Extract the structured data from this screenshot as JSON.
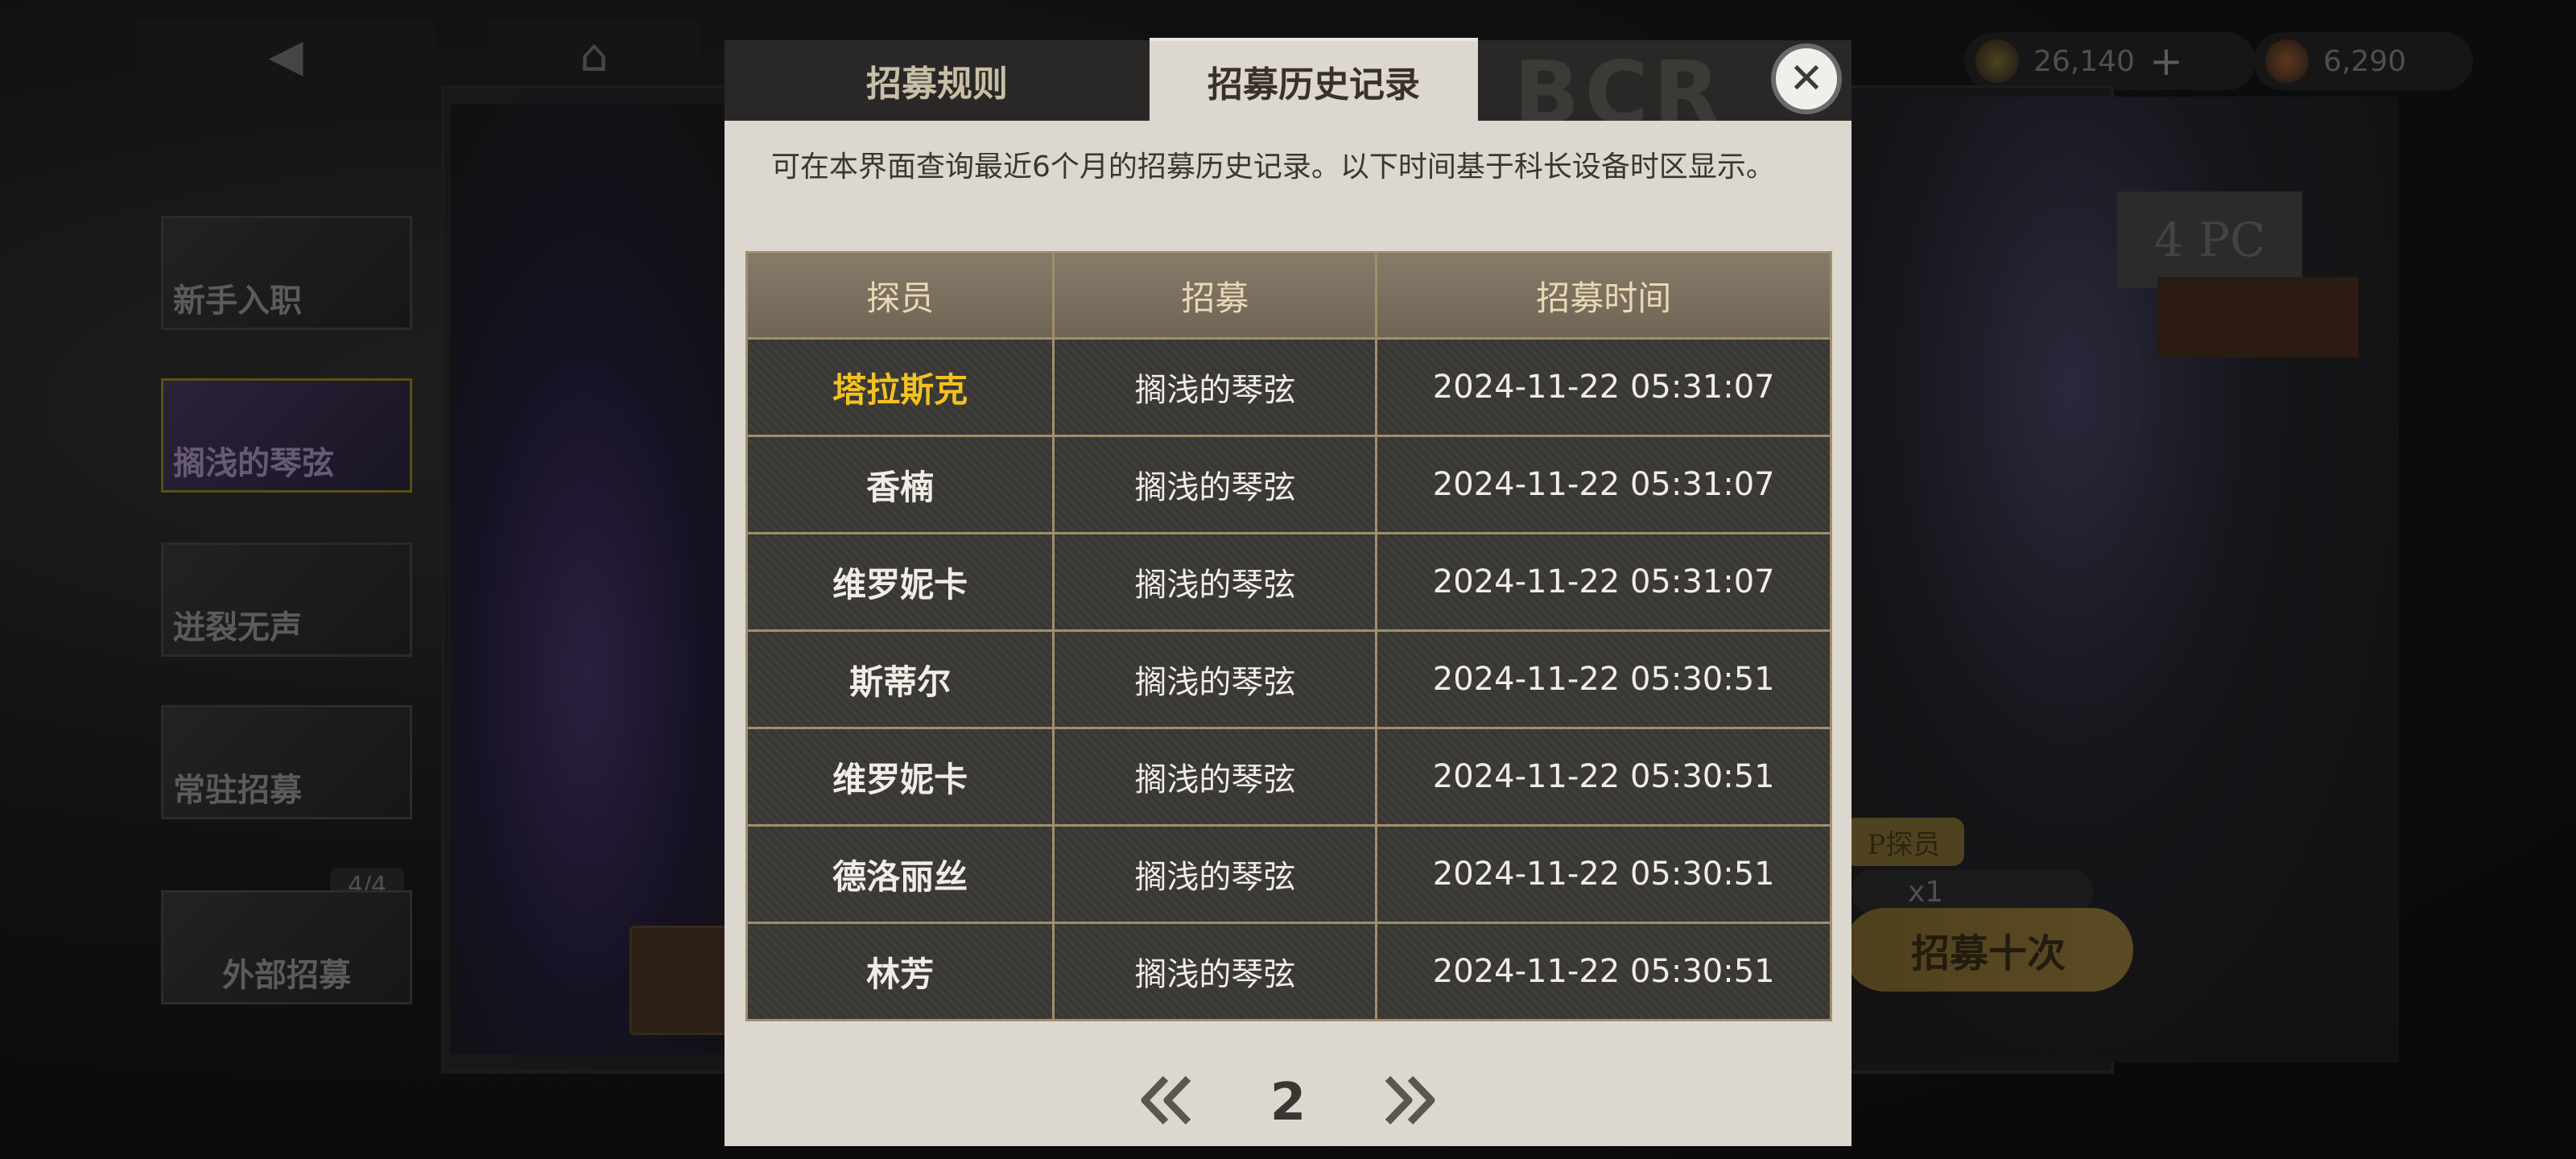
{
  "nav": {
    "back_icon": "◀",
    "home_icon": "⌂"
  },
  "currency": [
    {
      "icon": "gold-coin-icon",
      "value": "26,140",
      "plus": "+"
    },
    {
      "icon": "red-gem-icon",
      "value": "6,290"
    }
  ],
  "side_tabs": [
    {
      "label": "新手入职"
    },
    {
      "label": "搁浅的琴弦"
    },
    {
      "label": "迸裂无声"
    },
    {
      "label": "常驻招募"
    },
    {
      "label": "外部招募",
      "count": "4/4"
    }
  ],
  "background": {
    "price_tag": "4 PC",
    "chip": "P探员",
    "ticket": "x1",
    "recruit_ten": "招募十次"
  },
  "modal": {
    "logo": "BCR",
    "tabs": [
      {
        "label": "招募规则",
        "active": false
      },
      {
        "label": "招募历史记录",
        "active": true
      }
    ],
    "close_icon": "✕",
    "description": "可在本界面查询最近6个月的招募历史记录。以下时间基于科长设备时区显示。",
    "table": {
      "headers": [
        "探员",
        "招募",
        "招募时间"
      ],
      "rows": [
        {
          "agent": "塔拉斯克",
          "banner": "搁浅的琴弦",
          "time": "2024-11-22 05:31:07",
          "rare": true
        },
        {
          "agent": "香楠",
          "banner": "搁浅的琴弦",
          "time": "2024-11-22 05:31:07",
          "rare": false
        },
        {
          "agent": "维罗妮卡",
          "banner": "搁浅的琴弦",
          "time": "2024-11-22 05:31:07",
          "rare": false
        },
        {
          "agent": "斯蒂尔",
          "banner": "搁浅的琴弦",
          "time": "2024-11-22 05:30:51",
          "rare": false
        },
        {
          "agent": "维罗妮卡",
          "banner": "搁浅的琴弦",
          "time": "2024-11-22 05:30:51",
          "rare": false
        },
        {
          "agent": "德洛丽丝",
          "banner": "搁浅的琴弦",
          "time": "2024-11-22 05:30:51",
          "rare": false
        },
        {
          "agent": "林芳",
          "banner": "搁浅的琴弦",
          "time": "2024-11-22 05:30:51",
          "rare": false
        }
      ],
      "rare_color": "#f4c21f"
    },
    "pagination": {
      "current_page": "2"
    }
  }
}
